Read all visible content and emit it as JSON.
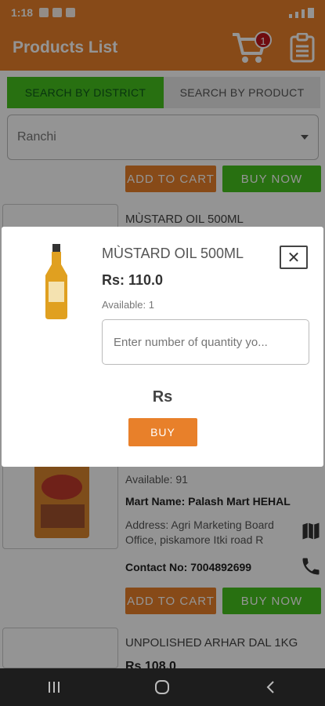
{
  "status_bar": {
    "time": "1:18"
  },
  "app_bar": {
    "title": "Products List",
    "cart_count": "1",
    "cart_icon": "cart-icon",
    "orders_icon": "clipboard-icon"
  },
  "tabs": [
    {
      "label": "SEARCH BY DISTRICT",
      "active": true
    },
    {
      "label": "SEARCH BY PRODUCT",
      "active": false
    }
  ],
  "district_select": {
    "value": "Ranchi"
  },
  "actions": {
    "add_to_cart": "ADD TO CART",
    "buy_now": "BUY NOW"
  },
  "products": [
    {
      "name": "MÙSTARD OIL 500ML"
    },
    {
      "available": "Available: 91",
      "mart": "Mart Name: Palash Mart HEHAL",
      "address": "Address: Agri Marketing Board Office, piskamore Itki road R",
      "contact": "Contact No: 7004892699"
    },
    {
      "name": "UNPOLISHED ARHAR DAL 1KG",
      "price": "Rs 108.0"
    }
  ],
  "modal": {
    "title": "MÙSTARD OIL 500ML",
    "price": "Rs: 110.0",
    "available": "Available: 1",
    "quantity_placeholder": "Enter number of quantity yo...",
    "total_label": "Rs",
    "buy_label": "BUY",
    "close_icon": "close-icon"
  },
  "colors": {
    "primary": "#e8802a",
    "accent_green": "#46c21e",
    "badge": "#c0161c"
  }
}
